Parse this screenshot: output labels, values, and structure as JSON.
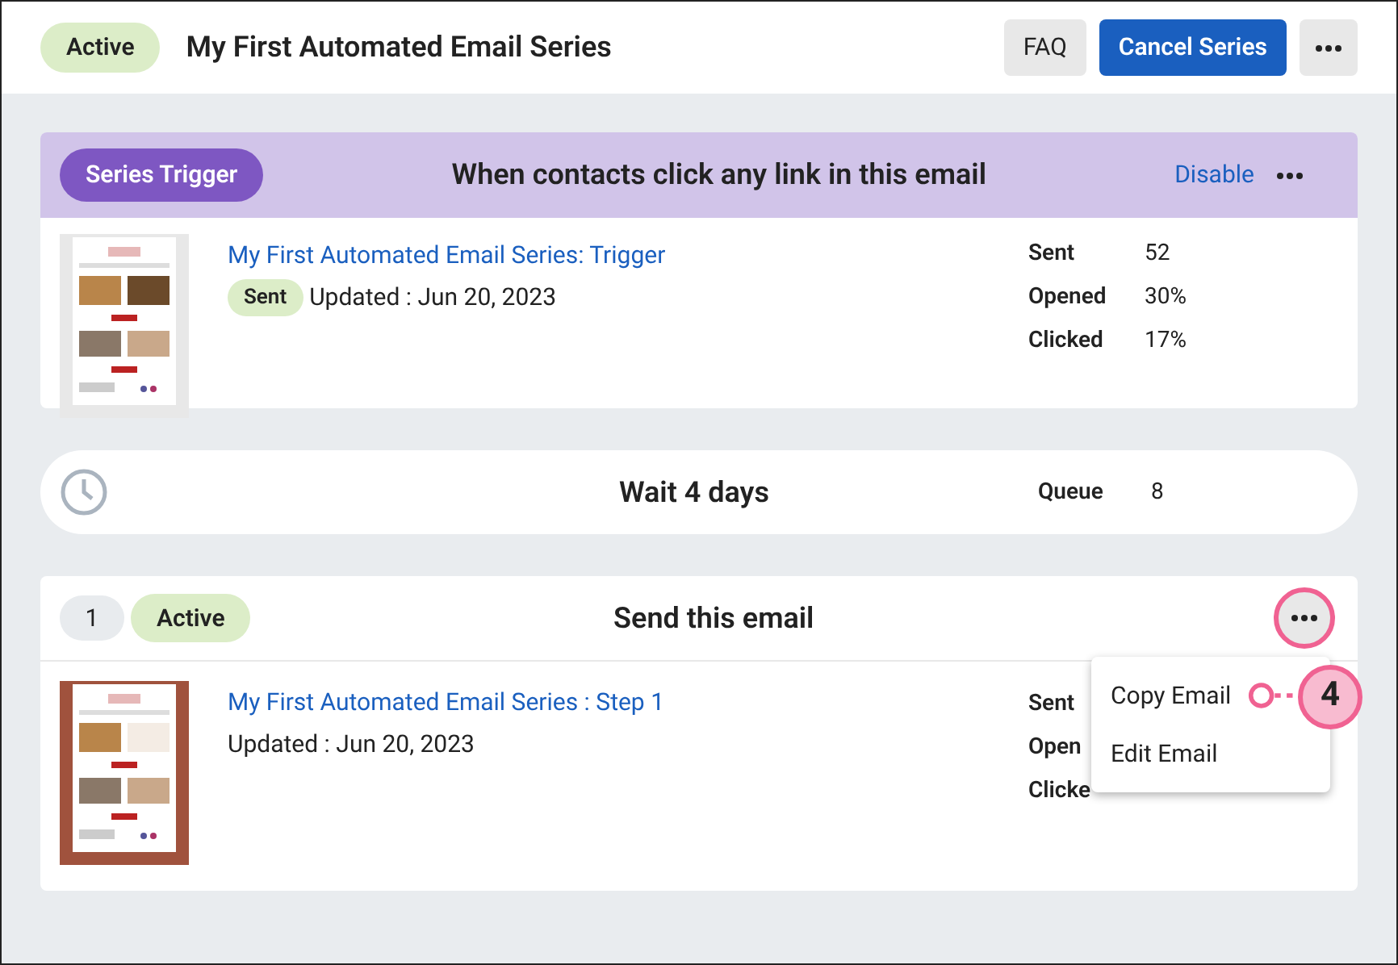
{
  "header": {
    "status": "Active",
    "title": "My First Automated Email Series",
    "buttons": [
      {
        "label": "FAQ",
        "kind": "secondary"
      },
      {
        "label": "Cancel Series",
        "kind": "primary"
      }
    ]
  },
  "trigger": {
    "badge": "Series Trigger",
    "title": "When contacts click any link in this email",
    "action": "Disable",
    "email": {
      "link": "My First Automated Email Series: Trigger",
      "badge": "Sent",
      "updated": "Updated : Jun 20, 2023"
    },
    "stats": [
      {
        "label": "Sent",
        "value": "52"
      },
      {
        "label": "Opened",
        "value": "30%"
      },
      {
        "label": "Clicked",
        "value": "17%"
      }
    ]
  },
  "wait": {
    "title": "Wait 4 days",
    "queue_label": "Queue",
    "queue_value": "8"
  },
  "step": {
    "number": "1",
    "status": "Active",
    "title": "Send this email",
    "email": {
      "link": "My First Automated Email Series : Step 1",
      "updated": "Updated : Jun 20, 2023"
    },
    "stats": [
      {
        "label": "Sent"
      },
      {
        "label": "Open"
      },
      {
        "label": "Clicke"
      }
    ],
    "menu": {
      "expanded": true,
      "items": [
        "Copy Email",
        "Edit Email"
      ]
    },
    "callout": "4"
  }
}
